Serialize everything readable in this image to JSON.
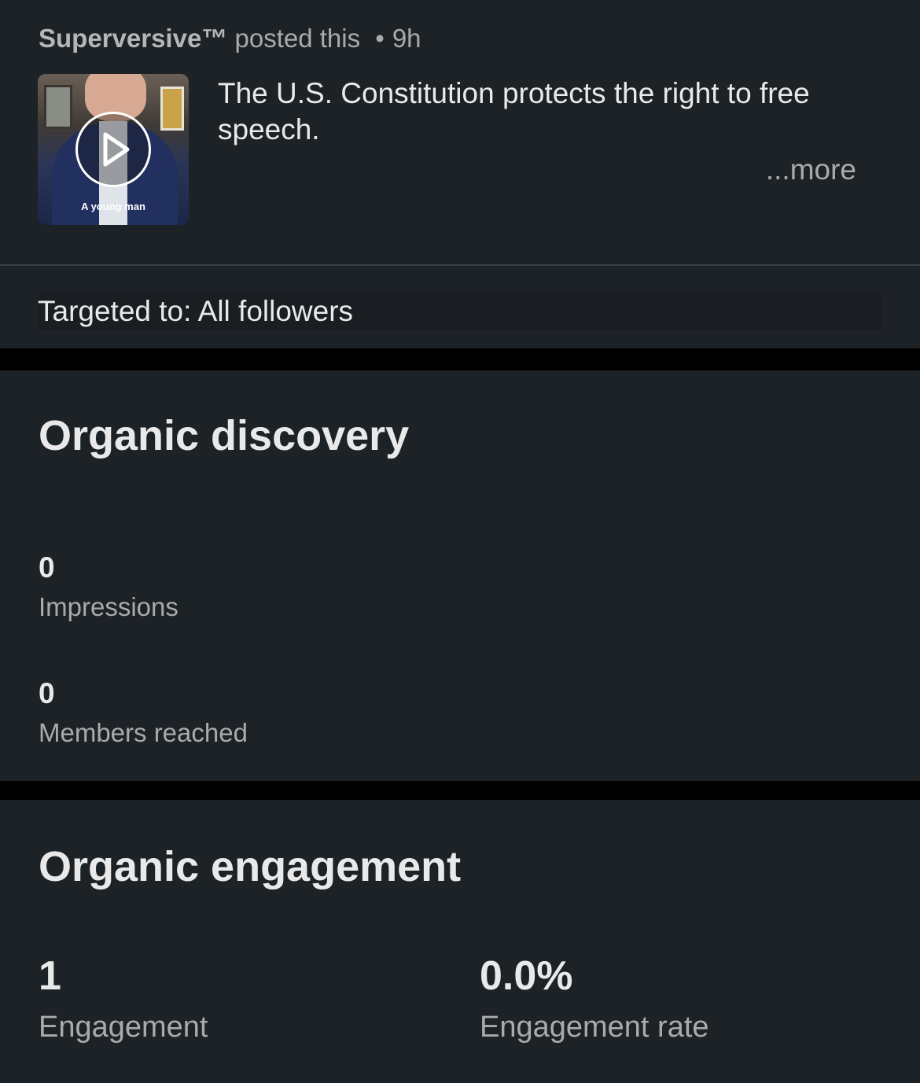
{
  "post": {
    "author": "Superversive™",
    "action": "posted this",
    "separator": "•",
    "time": "9h",
    "text": "The U.S. Constitution protects the right to free speech.",
    "more_label": "...more",
    "thumbnail_caption": "A young man",
    "targeted": "Targeted to: All followers"
  },
  "discovery": {
    "title": "Organic discovery",
    "metrics": [
      {
        "value": "0",
        "label": "Impressions"
      },
      {
        "value": "0",
        "label": "Members reached"
      }
    ]
  },
  "engagement": {
    "title": "Organic engagement",
    "metrics": [
      {
        "value": "1",
        "label": "Engagement"
      },
      {
        "value": "0.0%",
        "label": "Engagement rate"
      }
    ]
  },
  "colors": {
    "background": "#1d2226",
    "separator": "#000000",
    "text_primary": "#e9e9ea",
    "text_secondary": "#a8abae"
  }
}
